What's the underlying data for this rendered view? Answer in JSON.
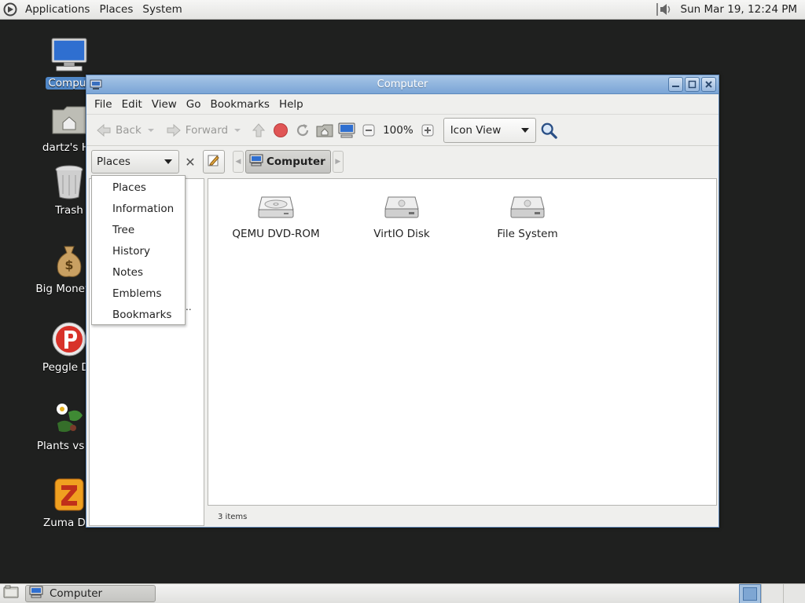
{
  "top_panel": {
    "menus": [
      "Applications",
      "Places",
      "System"
    ],
    "clock": "Sun Mar 19, 12:24 PM",
    "icons": {
      "logo": "distro-logo-icon",
      "volume": "volume-icon"
    }
  },
  "desktop": {
    "icons": [
      {
        "label": "Comput",
        "icon": "computer-icon"
      },
      {
        "label": "dartz's Ho",
        "icon": "home-folder-icon"
      },
      {
        "label": "Trash",
        "icon": "trash-icon"
      },
      {
        "label": "Big Money D",
        "icon": "money-bag-icon"
      },
      {
        "label": "Peggle De",
        "icon": "peggle-icon"
      },
      {
        "label": "Plants vs Zo",
        "icon": "plants-icon"
      },
      {
        "label": "Zuma Del",
        "icon": "zuma-icon"
      }
    ]
  },
  "window": {
    "title": "Computer",
    "menu": [
      "File",
      "Edit",
      "View",
      "Go",
      "Bookmarks",
      "Help"
    ],
    "toolbar": {
      "back": "Back",
      "forward": "Forward",
      "zoom": "100%",
      "view_mode": "Icon View"
    },
    "location": {
      "pane_selector": "Places",
      "crumb": "Computer"
    },
    "side_pane_options": [
      "Places",
      "Information",
      "Tree",
      "History",
      "Notes",
      "Emblems",
      "Bookmarks"
    ],
    "side_pane_truncated": "..",
    "files": [
      {
        "label": "QEMU DVD-ROM",
        "icon": "optical-drive-icon"
      },
      {
        "label": "VirtIO Disk",
        "icon": "hard-disk-icon"
      },
      {
        "label": "File System",
        "icon": "hard-disk-icon"
      }
    ],
    "status": "3 items"
  },
  "bottom_panel": {
    "task": "Computer"
  },
  "colors": {
    "desktop": "#1f201f",
    "titlebar": "#7aa5d6",
    "selection": "#4f86c6",
    "stop": "#e05555"
  }
}
